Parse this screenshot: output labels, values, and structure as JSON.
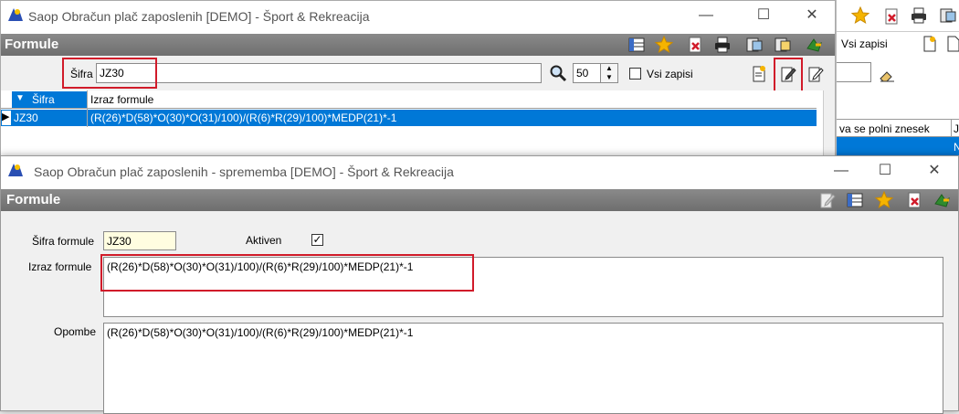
{
  "bg_window": {
    "title": "Saop Obračun plač zaposlenih [DEMO] - Šport & Rekreacija",
    "panel_title": "Formule",
    "search": {
      "label": "Šifra",
      "value": "JZ30",
      "page_size": "50",
      "all_records_label": "Vsi zapisi"
    },
    "table": {
      "columns": [
        "Šifra",
        "Izraz formule"
      ],
      "rows": [
        {
          "code": "JZ30",
          "expr": "(R(26)*D(58)*O(30)*O(31)/100)/(R(6)*R(29)/100)*MEDP(21)*-1"
        }
      ]
    }
  },
  "far_window": {
    "all_records_label": "Vsi zapisi",
    "column_header": "va se polni znesek",
    "column_header2": "J",
    "cell": "N"
  },
  "edit_window": {
    "title": "Saop Obračun plač zaposlenih - sprememba [DEMO] - Šport & Rekreacija",
    "panel_title": "Formule",
    "code_label": "Šifra formule",
    "code_value": "JZ30",
    "active_label": "Aktiven",
    "active_checked": true,
    "expr_label": "Izraz formule",
    "expr_value": "(R(26)*D(58)*O(30)*O(31)/100)/(R(6)*R(29)/100)*MEDP(21)*-1",
    "notes_label": "Opombe",
    "notes_value": "(R(26)*D(58)*O(30)*O(31)/100)/(R(6)*R(29)/100)*MEDP(21)*-1"
  },
  "colors": {
    "selection": "#0078d7",
    "header_bar": "#777777",
    "highlight": "#d11b2a",
    "code_field": "#fffde0"
  }
}
